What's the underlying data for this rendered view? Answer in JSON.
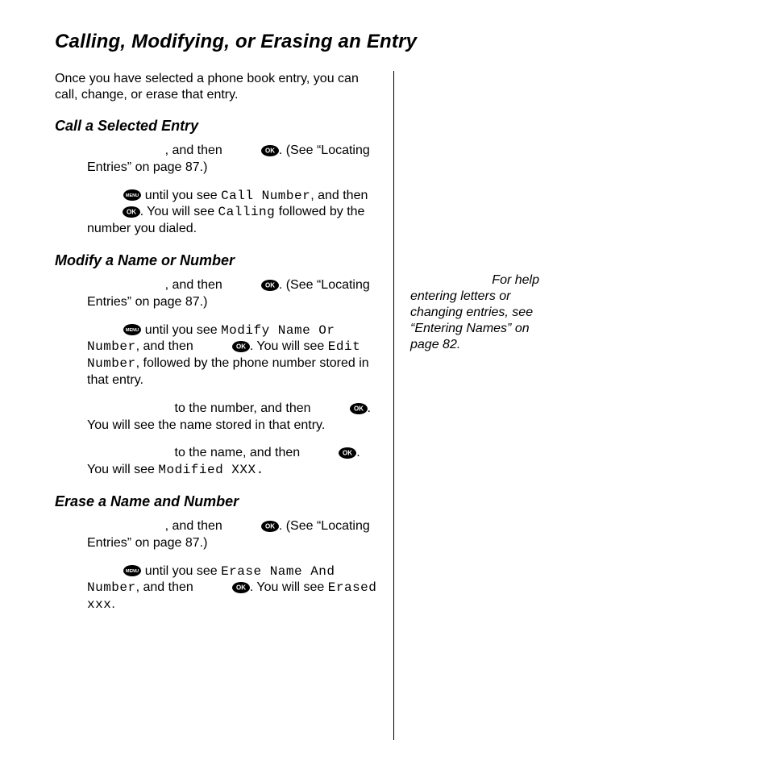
{
  "title": "Calling, Modifying, or Erasing an Entry",
  "intro": "Once you have selected a phone book entry, you can call, change, or erase that entry.",
  "call": {
    "heading": "Call a Selected Entry",
    "s1a": ", and then ",
    "s1b": ". (See “Locating Entries” on page 87.)",
    "s2a": " until you see ",
    "s2code1": "Call Number",
    "s2b": ", and then ",
    "s2c": ". You will see ",
    "s2code2": "Calling",
    "s2d": " followed by the number you dialed."
  },
  "modify": {
    "heading": "Modify a Name or Number",
    "s1a": ", and then ",
    "s1b": ". (See “Locating Entries” on page 87.)",
    "s2a": " until you see ",
    "s2code1": "Modify Name Or Number",
    "s2b": ", and then ",
    "s2c": ". You will see ",
    "s2code2": "Edit Number",
    "s2d": ", followed by the phone number stored in that entry.",
    "s3a": " to the number, and then ",
    "s3b": ". You will see the name stored in that entry.",
    "s4a": " to the name, and then ",
    "s4b": ". You will see ",
    "s4code": "Modified XXX."
  },
  "erase": {
    "heading": "Erase a Name and Number",
    "s1a": ", and then ",
    "s1b": ". (See “Locating Entries” on page 87.)",
    "s2a": " until you see ",
    "s2code1": "Erase Name And Number",
    "s2b": ", and then ",
    "s2c": ". You will see ",
    "s2code2": "Erased xxx",
    "s2d": "."
  },
  "sidenote_l1": "For help",
  "sidenote_rest": "entering letters or changing entries, see “Entering Names” on page 82."
}
